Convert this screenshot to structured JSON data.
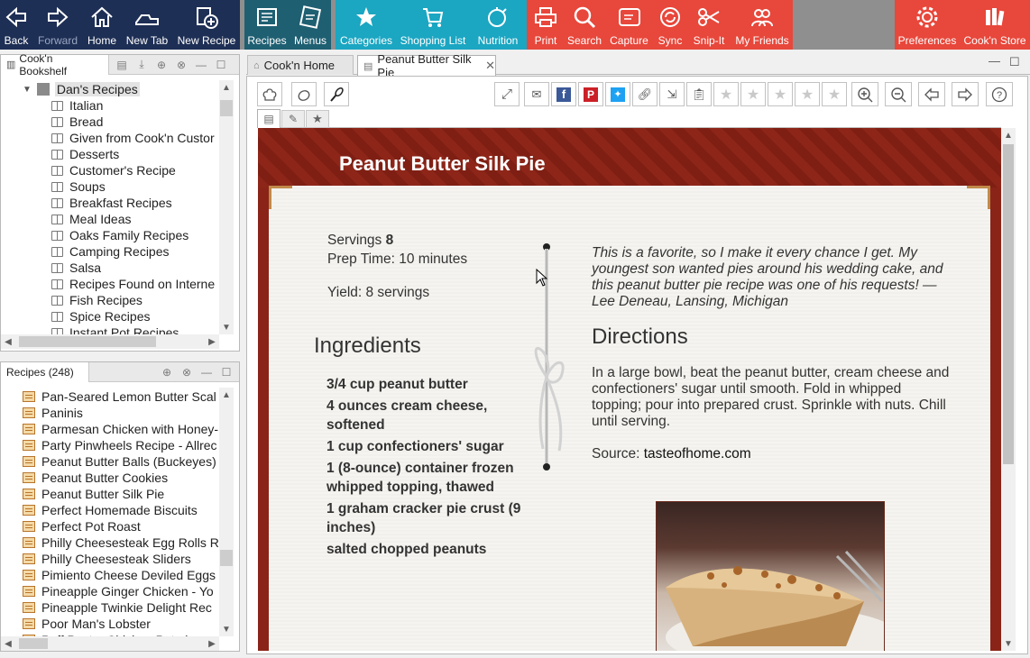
{
  "toolbar": {
    "nav": [
      {
        "label": "Back",
        "icon": "back-arrow-icon"
      },
      {
        "label": "Forward",
        "icon": "forward-arrow-icon"
      },
      {
        "label": "Home",
        "icon": "home-icon"
      },
      {
        "label": "New Tab",
        "icon": "new-tab-icon"
      },
      {
        "label": "New Recipe",
        "icon": "new-recipe-icon"
      }
    ],
    "plan": [
      {
        "label": "Recipes",
        "icon": "recipe-card-icon"
      },
      {
        "label": "Menus",
        "icon": "menus-icon"
      }
    ],
    "organize": [
      {
        "label": "Categories",
        "icon": "categories-star-icon"
      },
      {
        "label": "Shopping List",
        "icon": "shopping-cart-icon"
      },
      {
        "label": "Nutrition",
        "icon": "nutrition-icon"
      }
    ],
    "actions": [
      {
        "label": "Print",
        "icon": "print-icon"
      },
      {
        "label": "Search",
        "icon": "search-icon"
      },
      {
        "label": "Capture",
        "icon": "capture-icon"
      },
      {
        "label": "Sync",
        "icon": "sync-icon"
      },
      {
        "label": "Snip-It",
        "icon": "scissors-icon"
      },
      {
        "label": "My Friends",
        "icon": "friends-icon"
      }
    ],
    "settings": [
      {
        "label": "Preferences",
        "icon": "gear-icon"
      },
      {
        "label": "Cook'n Store",
        "icon": "bookshelf-icon"
      }
    ],
    "colors": {
      "nav": "#1e2f55",
      "plan": "#1f5f72",
      "organize": "#1ba6c2",
      "actions": "#e8473b",
      "gray": "#8f8f8f"
    }
  },
  "bookshelf": {
    "title": "Cook'n Bookshelf",
    "root": "Dan's Recipes",
    "items": [
      "Italian",
      "Bread",
      "Given from Cook'n Custor",
      "Desserts",
      "Customer's Recipe",
      "Soups",
      "Breakfast Recipes",
      "Meal Ideas",
      "Oaks Family Recipes",
      "Camping Recipes",
      "Salsa",
      "Recipes Found on Interne",
      "Fish Recipes",
      "Spice Recipes",
      "Instant Pot Recipes"
    ]
  },
  "recipes_panel": {
    "title": "Recipes (248)",
    "items": [
      "Pan-Seared Lemon Butter Scal",
      "Paninis",
      "Parmesan Chicken with Honey-",
      "Party Pinwheels Recipe - Allrec",
      "Peanut Butter Balls (Buckeyes)",
      "Peanut Butter Cookies",
      "Peanut Butter Silk Pie",
      "Perfect Homemade Biscuits",
      "Perfect Pot Roast",
      "Philly Cheesesteak Egg Rolls R",
      "Philly Cheesesteak Sliders",
      "Pimiento Cheese Deviled Eggs",
      "Pineapple Ginger Chicken - Yo",
      "Pineapple Twinkie Delight Rec",
      "Poor Man's Lobster",
      "Puff Pastry Chicken Pot pi"
    ]
  },
  "tabs": {
    "home": "Cook'n Home",
    "active": "Peanut Butter Silk Pie"
  },
  "recipe": {
    "title": "Peanut Butter Silk Pie",
    "servings_label": "Servings",
    "servings_value": "8",
    "prep_time": "Prep Time: 10 minutes",
    "yield": "Yield: 8 servings",
    "ingredients_heading": "Ingredients",
    "ingredients": [
      "3/4 cup peanut butter",
      "4 ounces cream cheese, softened",
      "1 cup confectioners' sugar",
      "1 (8-ounce) container frozen whipped topping, thawed",
      "1 graham cracker pie crust (9 inches)",
      "salted chopped peanuts"
    ],
    "intro": "This is a favorite, so I make it every chance I get. My youngest son wanted pies around his wedding cake, and this peanut butter pie recipe was one of his requests! —Lee Deneau, Lansing, Michigan",
    "directions_heading": "Directions",
    "directions": "In a large bowl, beat the peanut butter, cream cheese and confectioners' sugar until smooth. Fold in whipped topping; pour into prepared crust. Sprinkle with nuts. Chill until serving.",
    "source_label": "Source:",
    "source_value": "tasteofhome.com"
  }
}
